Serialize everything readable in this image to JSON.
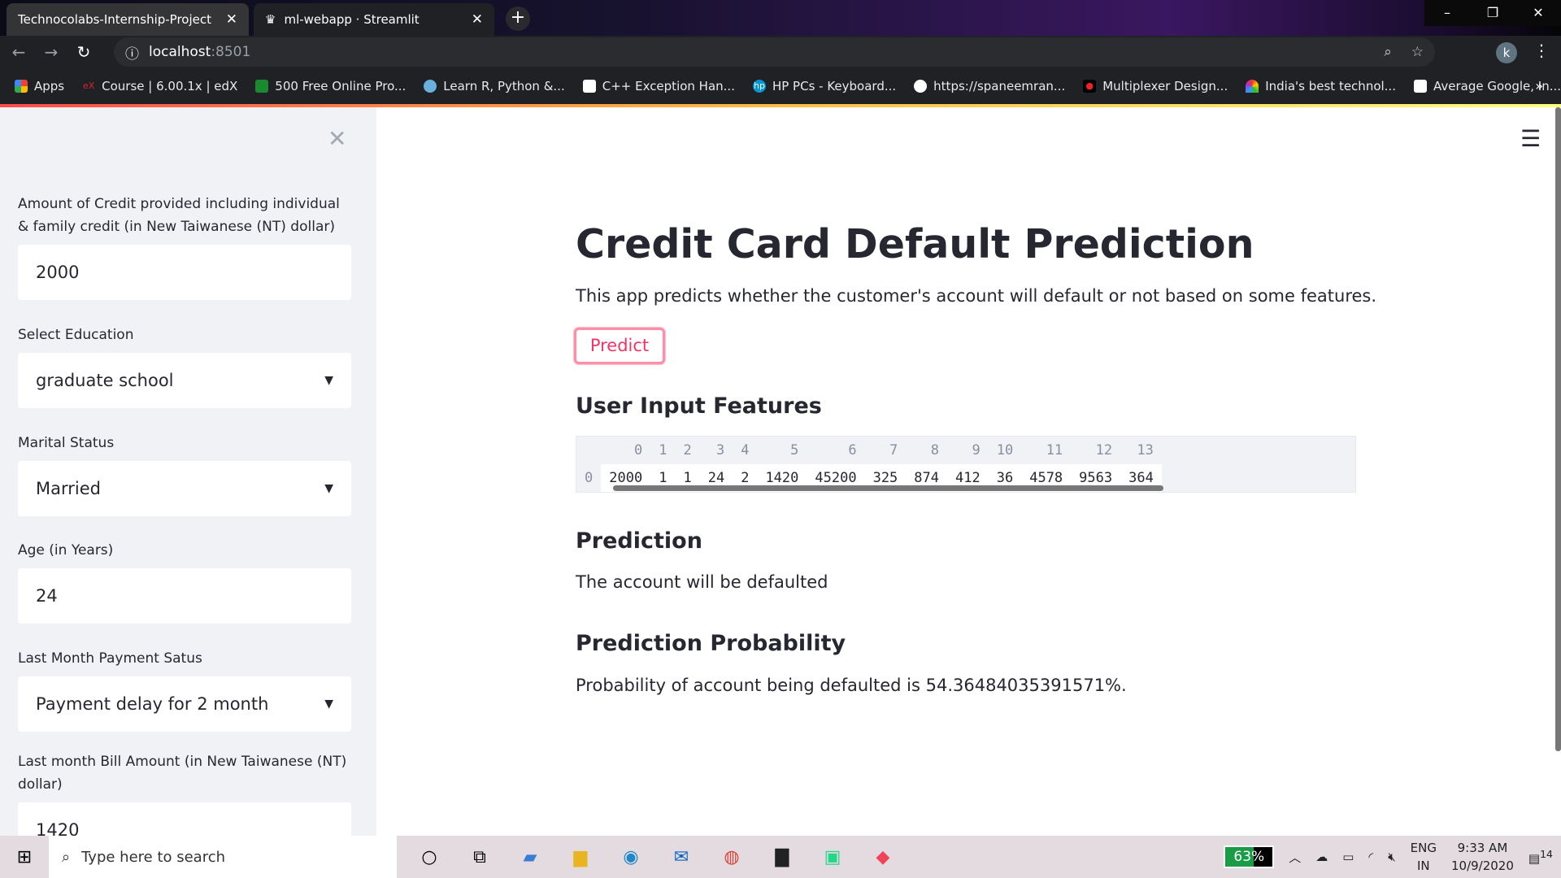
{
  "browser": {
    "tabs": [
      {
        "title": "Technocolabs-Internship-Project",
        "active": false
      },
      {
        "title": "ml-webapp · Streamlit",
        "active": true
      }
    ],
    "url_host": "localhost",
    "url_port": ":8501",
    "profile_initial": "k",
    "bookmarks": [
      "Apps",
      "Course | 6.00.1x | edX",
      "500 Free Online Pro...",
      "Learn R, Python &...",
      "C++ Exception Han...",
      "HP PCs - Keyboard...",
      "https://spaneemran...",
      "Multiplexer Design...",
      "India's best technol...",
      "Average Google, In..."
    ]
  },
  "sidebar": {
    "fields": [
      {
        "label": "Amount of Credit provided including individual & family credit (in New Taiwanese (NT) dollar)",
        "value": "2000",
        "type": "number"
      },
      {
        "label": "Select Education",
        "value": "graduate school",
        "type": "select"
      },
      {
        "label": "Marital Status",
        "value": "Married",
        "type": "select"
      },
      {
        "label": "Age (in Years)",
        "value": "24",
        "type": "number"
      },
      {
        "label": "Last Month Payment Satus",
        "value": "Payment delay for 2 month",
        "type": "select"
      },
      {
        "label": "Last month Bill Amount (in New Taiwanese (NT) dollar)",
        "value": "1420",
        "type": "number"
      }
    ]
  },
  "main": {
    "title": "Credit Card Default Prediction",
    "description": "This app predicts whether the customer's account will default or not based on some features.",
    "predict_label": "Predict",
    "features_heading": "User Input Features",
    "table": {
      "columns": [
        "0",
        "1",
        "2",
        "3",
        "4",
        "5",
        "6",
        "7",
        "8",
        "9",
        "10",
        "11",
        "12",
        "13"
      ],
      "rows": [
        {
          "index": "0",
          "values": [
            "2000",
            "1",
            "1",
            "24",
            "2",
            "1420",
            "45200",
            "325",
            "874",
            "412",
            "36",
            "4578",
            "9563",
            "364"
          ]
        }
      ]
    },
    "prediction_heading": "Prediction",
    "prediction_text": "The account will be defaulted",
    "probability_heading": "Prediction Probability",
    "probability_text": "Probability of account being defaulted is 54.36484035391571%."
  },
  "taskbar": {
    "search_placeholder": "Type here to search",
    "battery": "63%",
    "lang1": "ENG",
    "lang2": "IN",
    "time": "9:33 AM",
    "date": "10/9/2020",
    "notifications": "14"
  },
  "colors": {
    "accent": "#f63366",
    "sidebar_bg": "#f0f2f6",
    "text": "#262730"
  }
}
